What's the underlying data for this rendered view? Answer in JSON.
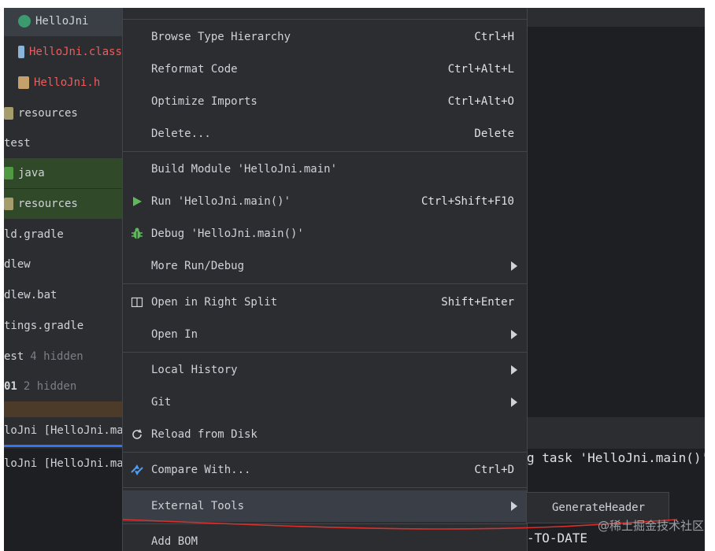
{
  "project_tree": [
    {
      "label": "HelloJni",
      "icon": "class-icon",
      "style": "sel"
    },
    {
      "label": "HelloJni.class",
      "icon": "class-file-icon",
      "style": "red"
    },
    {
      "label": "HelloJni.h",
      "icon": "header-file-icon",
      "style": "red"
    },
    {
      "label": "resources",
      "icon": "resources-folder-icon",
      "style": ""
    },
    {
      "label": "test",
      "icon": "",
      "style": ""
    },
    {
      "label": "java",
      "icon": "java-folder-icon",
      "style": "green"
    },
    {
      "label": "resources",
      "icon": "resources-folder-icon",
      "style": "green"
    },
    {
      "label": "ld.gradle",
      "icon": "",
      "style": ""
    },
    {
      "label": "dlew",
      "icon": "",
      "style": ""
    },
    {
      "label": "dlew.bat",
      "icon": "",
      "style": ""
    },
    {
      "label": "tings.gradle",
      "icon": "",
      "style": ""
    },
    {
      "label": "est",
      "hint": "4 hidden",
      "icon": "",
      "style": ""
    },
    {
      "label": "01",
      "hint": "2 hidden",
      "icon": "",
      "style": ""
    }
  ],
  "run_tabs": [
    {
      "label": "loJni [HelloJni.ma"
    },
    {
      "label": "loJni [HelloJni.ma"
    }
  ],
  "console": {
    "line1": "g task 'HelloJni.main()'",
    "line2": "-TO-DATE"
  },
  "menu": {
    "items": [
      {
        "label": "Browse Type Hierarchy",
        "shortcut": "Ctrl+H"
      },
      {
        "label": "Reformat Code",
        "shortcut": "Ctrl+Alt+L"
      },
      {
        "label": "Optimize Imports",
        "shortcut": "Ctrl+Alt+O"
      },
      {
        "label": "Delete...",
        "shortcut": "Delete"
      },
      {
        "label": "Build Module 'HelloJni.main'",
        "shortcut": ""
      },
      {
        "label": "Run 'HelloJni.main()'",
        "shortcut": "Ctrl+Shift+F10",
        "icon": "run-icon"
      },
      {
        "label": "Debug 'HelloJni.main()'",
        "shortcut": "",
        "icon": "debug-icon"
      },
      {
        "label": "More Run/Debug",
        "shortcut": "",
        "submenu": true
      },
      {
        "label": "Open in Right Split",
        "shortcut": "Shift+Enter",
        "icon": "split-icon"
      },
      {
        "label": "Open In",
        "shortcut": "",
        "submenu": true
      },
      {
        "label": "Local History",
        "shortcut": "",
        "submenu": true
      },
      {
        "label": "Git",
        "shortcut": "",
        "submenu": true
      },
      {
        "label": "Reload from Disk",
        "shortcut": "",
        "icon": "reload-icon"
      },
      {
        "label": "Compare With...",
        "shortcut": "Ctrl+D",
        "icon": "compare-icon"
      },
      {
        "label": "External Tools",
        "shortcut": "",
        "submenu": true
      },
      {
        "label": "Add BOM",
        "shortcut": ""
      }
    ]
  },
  "submenu": {
    "label": "GenerateHeader"
  },
  "watermark": "@稀土掘金技术社区",
  "colors": {
    "accent": "#3574f0",
    "run_green": "#5fb85b",
    "annotation_red": "#d9302c"
  }
}
